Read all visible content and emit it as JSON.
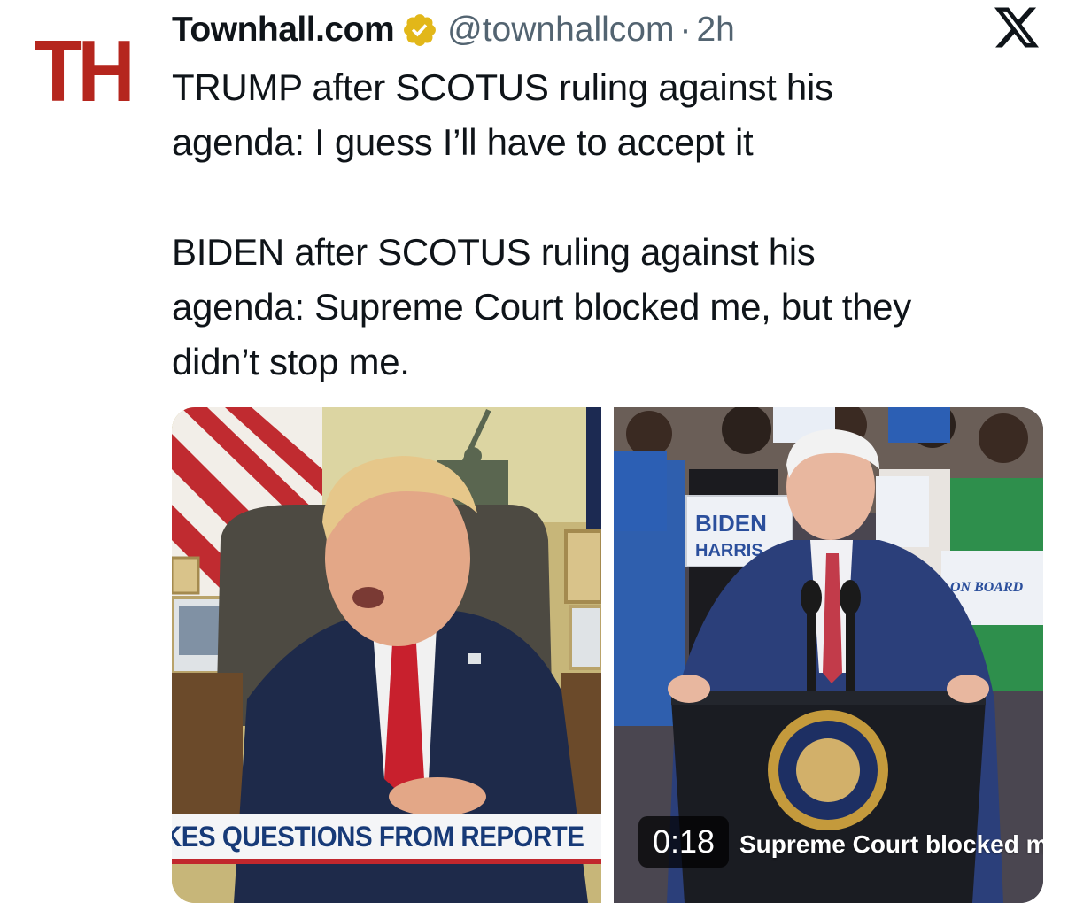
{
  "account": {
    "avatar_text": "TH",
    "display_name": "Townhall.com",
    "handle": "@townhallcom",
    "separator": "·",
    "time": "2h",
    "verified_icon": "verified-badge-icon",
    "brand_color": "#b5261e"
  },
  "platform": {
    "logo_icon": "x-logo-icon"
  },
  "tweet": {
    "paragraph1_line1": "TRUMP after SCOTUS ruling against his",
    "paragraph1_line2": "agenda: I guess I’ll have to accept it",
    "paragraph2_line1": "BIDEN after SCOTUS ruling against his",
    "paragraph2_line2": "agenda: Supreme Court blocked me, but they",
    "paragraph2_line3": "didn’t stop me."
  },
  "media": {
    "left_chyron": "KES QUESTIONS FROM REPORTE",
    "right_caption": "Supreme Court blocked me",
    "video_duration": "0:18",
    "signs": {
      "biden": "BIDEN",
      "harris": "HARRIS",
      "on_board": "ON BOARD"
    }
  }
}
